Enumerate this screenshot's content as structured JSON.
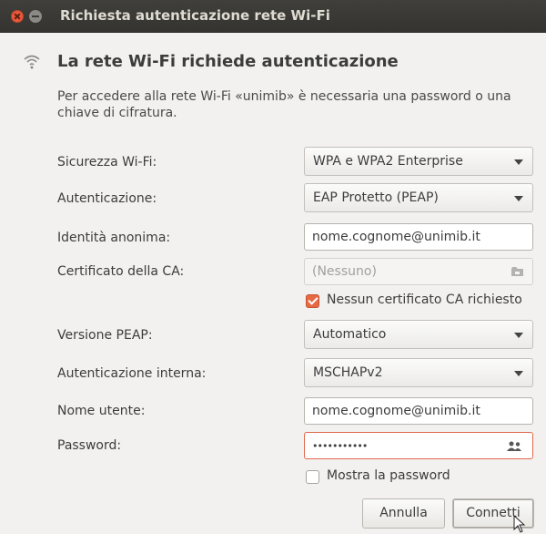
{
  "window": {
    "title": "Richiesta autenticazione rete Wi-Fi"
  },
  "header": {
    "title": "La rete Wi-Fi richiede autenticazione",
    "description": "Per accedere alla rete Wi-Fi «unimib» è necessaria una password o una chiave di cifratura."
  },
  "form": {
    "security_label": "Sicurezza Wi-Fi:",
    "security_value": "WPA e WPA2 Enterprise",
    "auth_label": "Autenticazione:",
    "auth_value": "EAP Protetto (PEAP)",
    "anon_label": "Identità anonima:",
    "anon_value": "nome.cognome@unimib.it",
    "ca_label": "Certificato della CA:",
    "ca_value": "(Nessuno)",
    "no_ca_label": "Nessun certificato CA richiesto",
    "no_ca_checked": true,
    "peap_label": "Versione PEAP:",
    "peap_value": "Automatico",
    "inner_label": "Autenticazione interna:",
    "inner_value": "MSCHAPv2",
    "user_label": "Nome utente:",
    "user_value": "nome.cognome@unimib.it",
    "password_label": "Password:",
    "password_value": "•••••••••••",
    "show_password_label": "Mostra la password",
    "show_password_checked": false
  },
  "buttons": {
    "cancel": "Annulla",
    "connect": "Connetti"
  },
  "colors": {
    "titlebar": "#3c3b37",
    "accent": "#e66a44",
    "background": "#f2f1f0"
  },
  "icons": [
    "close-icon",
    "minimize-icon",
    "wifi-icon",
    "file-chooser-icon",
    "user-icon",
    "cursor-icon"
  ]
}
